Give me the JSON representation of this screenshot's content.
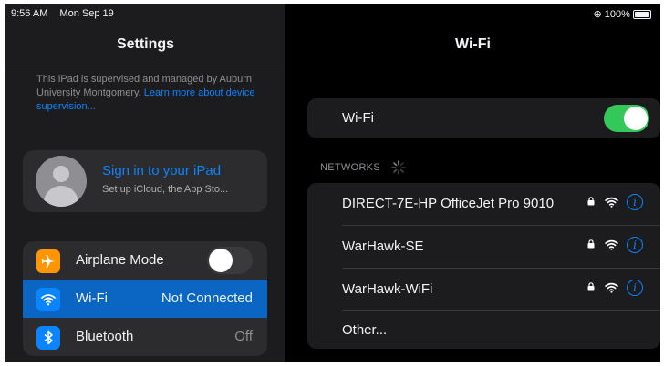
{
  "status_bar": {
    "time": "9:56 AM",
    "date": "Mon Sep 19",
    "battery": "100%"
  },
  "sidebar": {
    "title": "Settings",
    "supervision_text": "This iPad is supervised and managed by Auburn University Montgomery.",
    "supervision_link": "Learn more about device supervision...",
    "account": {
      "title": "Sign in to your iPad",
      "subtitle": "Set up iCloud, the App Sto..."
    },
    "items": [
      {
        "label": "Airplane Mode",
        "icon": "airplane-icon",
        "icon_color": "#ff9500",
        "toggle": "off",
        "value": ""
      },
      {
        "label": "Wi-Fi",
        "icon": "wifi-icon",
        "icon_color": "#0a84ff",
        "value": "Not Connected",
        "selected": true
      },
      {
        "label": "Bluetooth",
        "icon": "bluetooth-icon",
        "icon_color": "#0a84ff",
        "value": "Off"
      }
    ]
  },
  "detail": {
    "title": "Wi-Fi",
    "wifi_label": "Wi-Fi",
    "wifi_enabled": true,
    "networks_header": "NETWORKS",
    "networks": [
      {
        "name": "DIRECT-7E-HP OfficeJet Pro 9010",
        "secured": true
      },
      {
        "name": "WarHawk-SE",
        "secured": true
      },
      {
        "name": "WarHawk-WiFi",
        "secured": true
      }
    ],
    "other_label": "Other..."
  },
  "colors": {
    "accent": "#0a84ff",
    "toggle_on": "#34c759",
    "selected_row": "#0a66c2",
    "airplane": "#ff9500"
  }
}
